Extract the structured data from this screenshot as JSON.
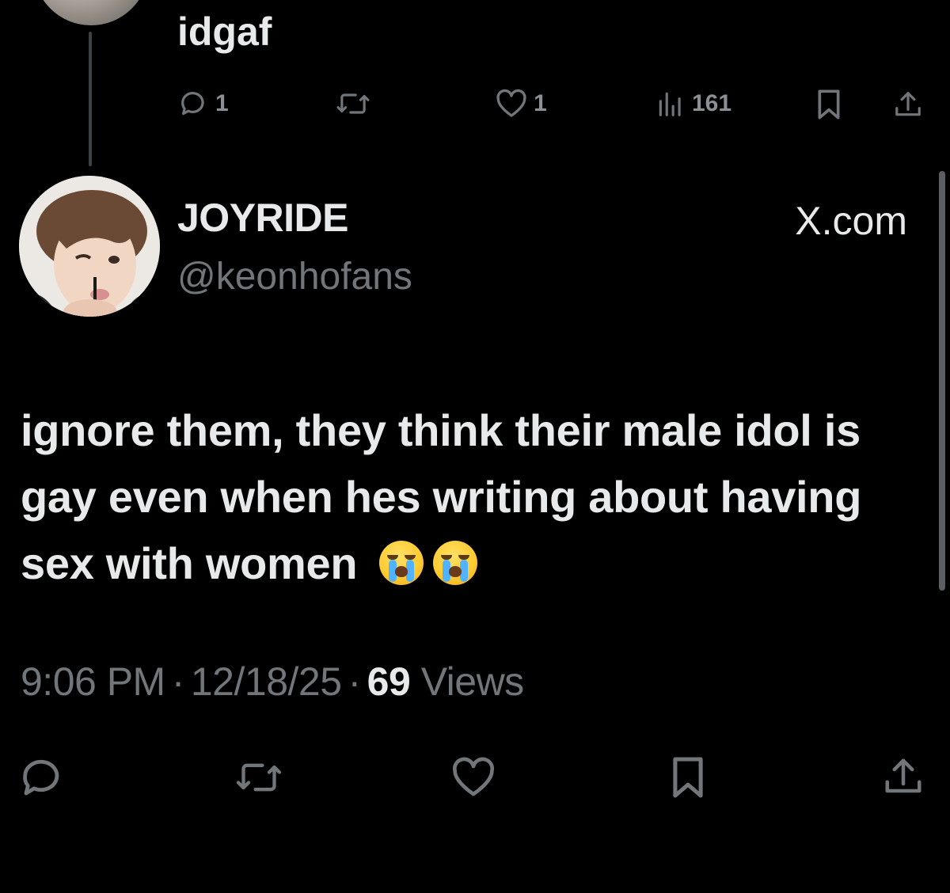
{
  "previous_tweet": {
    "text": "idgaf",
    "actions": {
      "reply_count": "1",
      "like_count": "1",
      "views_count": "161"
    }
  },
  "tweet": {
    "display_name": "JOYRIDE",
    "handle": "@keonhofans",
    "source_badge": "X.com",
    "body": "ignore them, they think their male idol is gay even when hes writing about having sex with women",
    "emojis": [
      "loudly-crying-face",
      "loudly-crying-face"
    ],
    "time": "9:06 PM",
    "date": "12/18/25",
    "views_count": "69",
    "views_label": "Views",
    "separator": "·"
  },
  "icons": {
    "reply": "reply-icon",
    "retweet": "retweet-icon",
    "like": "heart-icon",
    "views": "views-chart-icon",
    "bookmark": "bookmark-icon",
    "share": "share-icon"
  },
  "colors": {
    "background": "#000000",
    "text_primary": "#e7e9ea",
    "text_secondary": "#71767b"
  }
}
